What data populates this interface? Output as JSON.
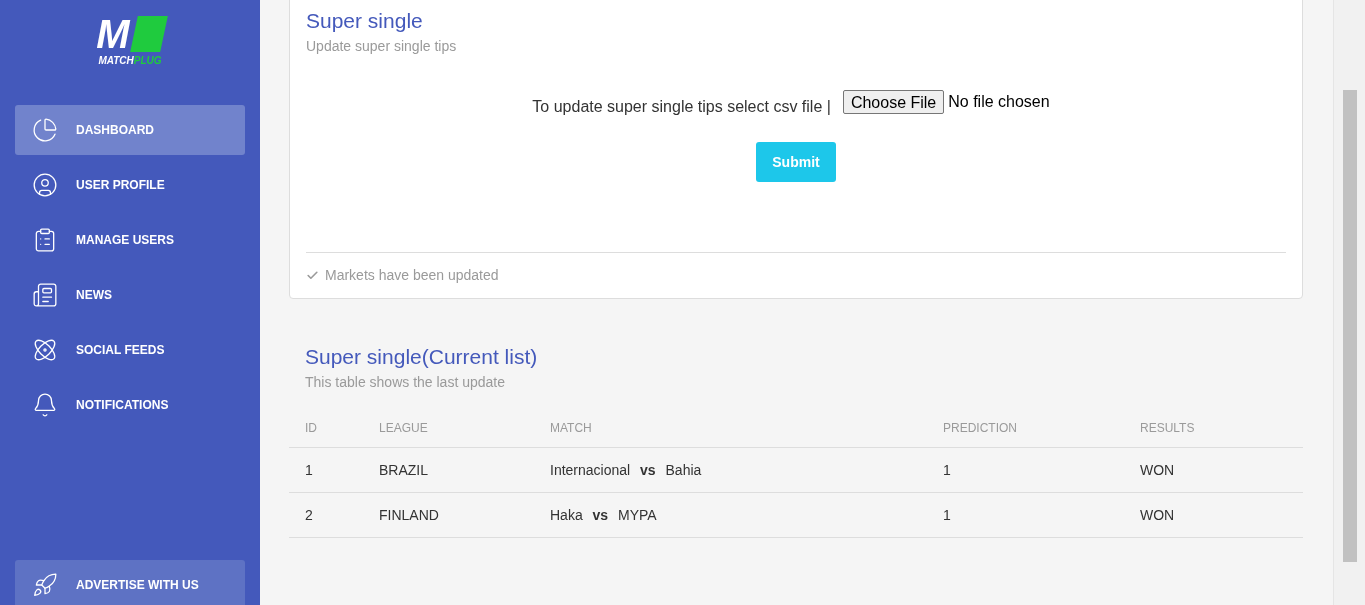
{
  "logo": {
    "mark": "M",
    "word_1": "MATCH",
    "word_2": "PLUG"
  },
  "sidebar": {
    "items": [
      {
        "label": "DASHBOARD",
        "selected": true
      },
      {
        "label": "USER PROFILE",
        "selected": false
      },
      {
        "label": "MANAGE USERS",
        "selected": false
      },
      {
        "label": "NEWS",
        "selected": false
      },
      {
        "label": "SOCIAL FEEDS",
        "selected": false
      },
      {
        "label": "NOTIFICATIONS",
        "selected": false
      }
    ],
    "footer_item": {
      "label": "ADVERTISE WITH US"
    }
  },
  "upload_card": {
    "title": "Super single",
    "subtitle": "Update super single tips",
    "prompt": "To update super single tips select csv file |",
    "file_button": "Choose File",
    "file_status": "No file chosen",
    "submit": "Submit",
    "footer": "Markets have been updated"
  },
  "table_section": {
    "title": "Super single(Current list)",
    "subtitle": "This table shows the last update",
    "columns": [
      "ID",
      "LEAGUE",
      "MATCH",
      "PREDICTION",
      "RESULTS"
    ],
    "rows": [
      [
        "1",
        "BRAZIL",
        "Internacional **vs** Bahia",
        "1",
        "WON"
      ],
      [
        "2",
        "FINLAND",
        "Haka **vs** MYPA",
        "1",
        "WON"
      ]
    ]
  }
}
